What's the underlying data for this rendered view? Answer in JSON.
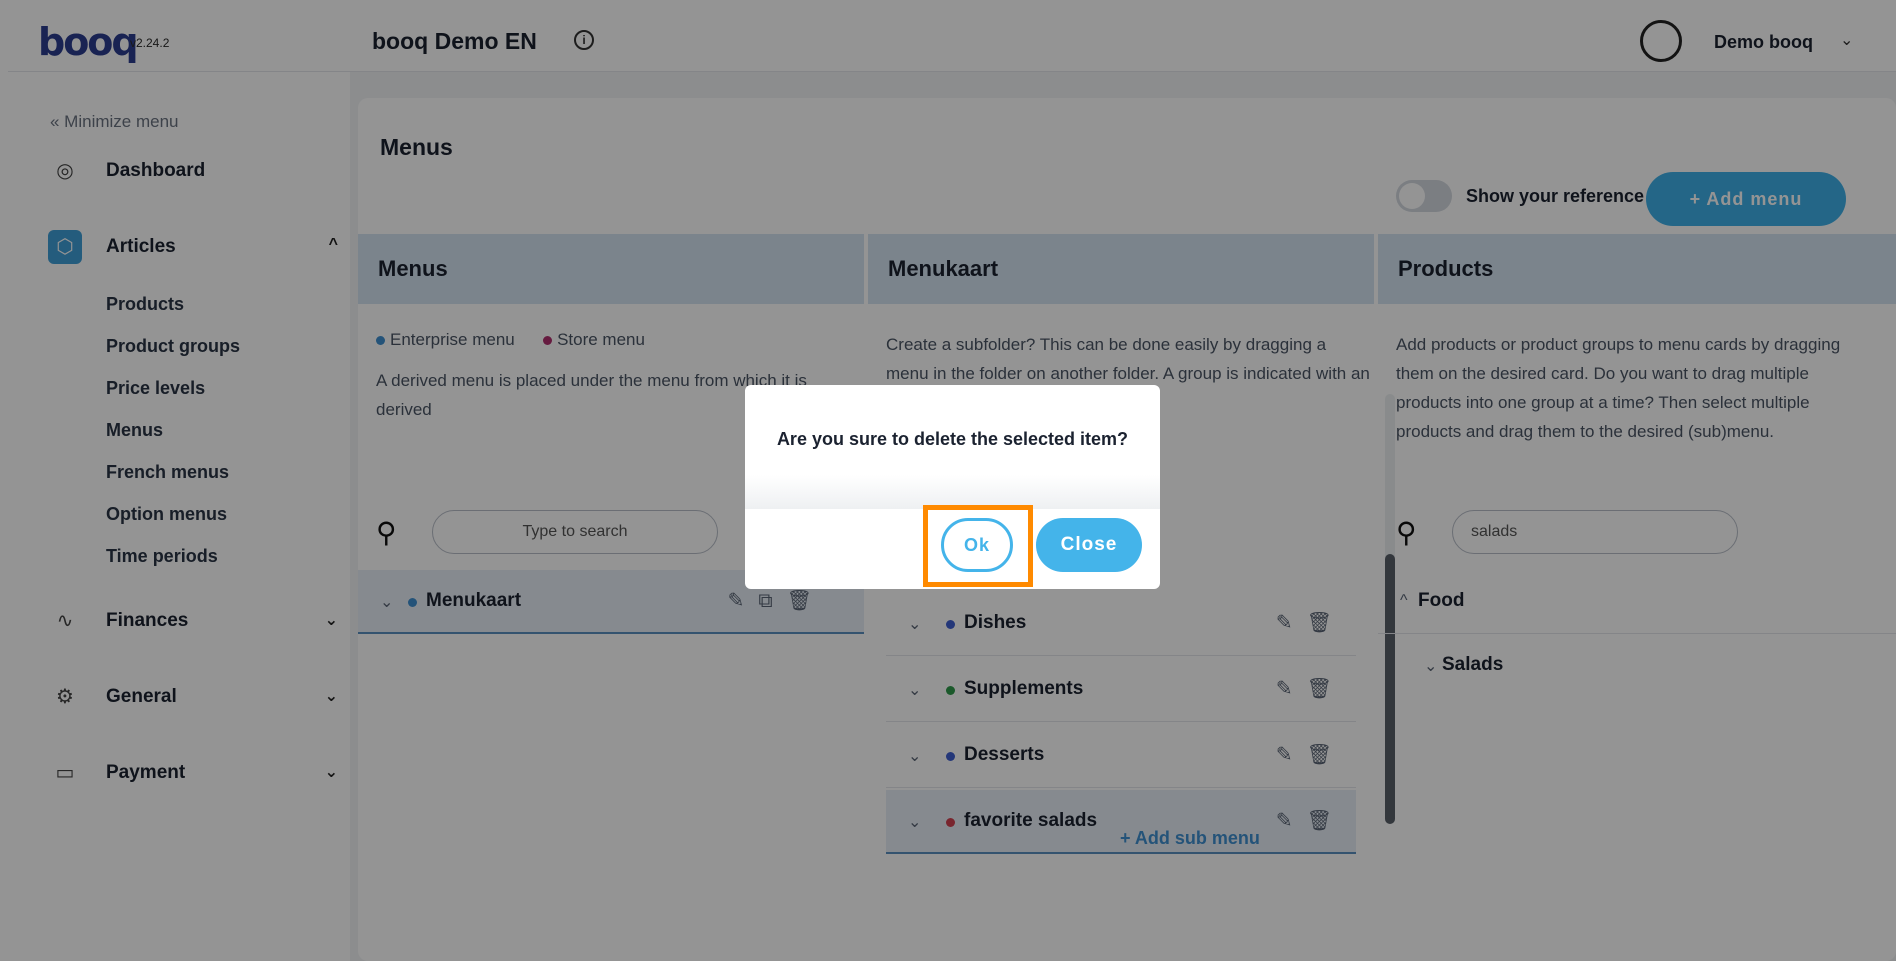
{
  "header": {
    "logo": "booq",
    "version": "v2.24.2",
    "store_title": "booq Demo EN",
    "user_name": "Demo booq"
  },
  "sidebar": {
    "minimize_label": "« Minimize menu",
    "items": [
      {
        "label": "Dashboard",
        "icon": "compass-icon"
      },
      {
        "label": "Articles",
        "icon": "box-icon",
        "active": true,
        "expanded": true
      },
      {
        "label": "Finances",
        "icon": "pulse-icon"
      },
      {
        "label": "General",
        "icon": "gear-icon"
      },
      {
        "label": "Payment",
        "icon": "card-icon"
      }
    ],
    "articles_subitems": [
      "Products",
      "Product groups",
      "Price levels",
      "Menus",
      "French menus",
      "Option menus",
      "Time periods"
    ]
  },
  "main": {
    "title": "Menus",
    "toggle_label": "Show your reference",
    "add_menu_label": "+ Add menu",
    "columns": {
      "menus": {
        "header": "Menus",
        "legend_enterprise": "Enterprise menu",
        "legend_store": "Store menu",
        "description": "A derived menu is placed under the menu from which it is derived",
        "search_placeholder": "Type to search",
        "rows": [
          {
            "label": "Menukaart",
            "dot_color": "#3f90d0"
          }
        ]
      },
      "menukaart": {
        "header": "Menukaart",
        "description": "Create a subfolder? This can be done easily by dragging a menu in the folder on another folder. A group is indicated with an *",
        "rows": [
          {
            "label": "Dishes",
            "dot_color": "#3f5fd0"
          },
          {
            "label": "Supplements",
            "dot_color": "#2f9a4a"
          },
          {
            "label": "Desserts",
            "dot_color": "#3f5fd0"
          },
          {
            "label": "favorite salads",
            "dot_color": "#d04050"
          }
        ],
        "add_sub_label": "+ Add sub menu"
      },
      "products": {
        "header": "Products",
        "description": "Add products or product groups to menu cards by dragging them on the desired card. Do you want to drag multiple products into one group at a time? Then select multiple products and drag them to the desired (sub)menu.",
        "search_value": "salads",
        "tree": [
          {
            "label": "Food"
          },
          {
            "label": "Salads"
          }
        ]
      }
    }
  },
  "dialog": {
    "message": "Are you sure to delete the selected item?",
    "ok_label": "Ok",
    "close_label": "Close"
  },
  "colors": {
    "accent": "#44b4ea",
    "brand": "#2c3d8f",
    "highlight": "#ff8a00",
    "enterprise_dot": "#3f90d0",
    "store_dot": "#b0306f"
  }
}
